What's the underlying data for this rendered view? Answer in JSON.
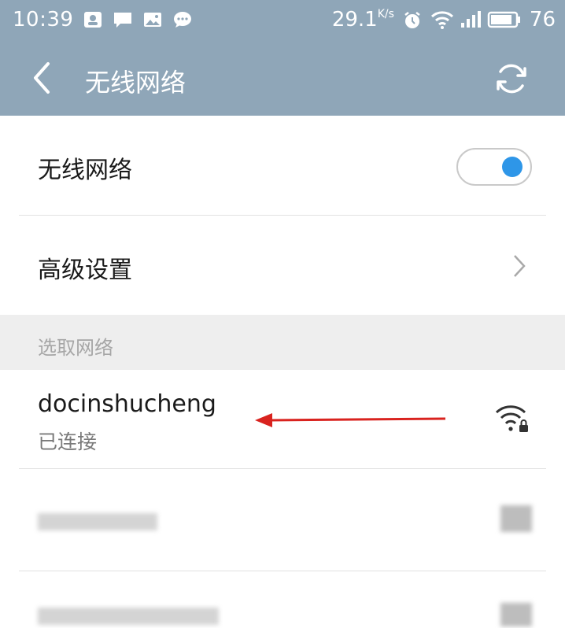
{
  "status_bar": {
    "time": "10:39",
    "speed": "29.1",
    "speed_unit": "K/s",
    "battery": "76",
    "notif_icons": [
      "person-icon",
      "message-icon",
      "image-icon",
      "chat-bubble-icon"
    ],
    "right_icons": [
      "alarm-icon",
      "wifi-icon",
      "signal-icon",
      "battery-icon"
    ]
  },
  "header": {
    "title": "无线网络",
    "back_icon": "chevron-left-icon",
    "refresh_icon": "refresh-icon",
    "background": "#8fa6b8"
  },
  "settings": {
    "wifi_label": "无线网络",
    "wifi_enabled": true,
    "advanced_label": "高级设置"
  },
  "networks": {
    "section_label": "选取网络",
    "items": [
      {
        "name": "docinshucheng",
        "status": "已连接",
        "icon": "wifi-locked-icon"
      }
    ]
  },
  "colors": {
    "accent": "#2e96e8",
    "annotation_arrow": "#d9231f"
  }
}
